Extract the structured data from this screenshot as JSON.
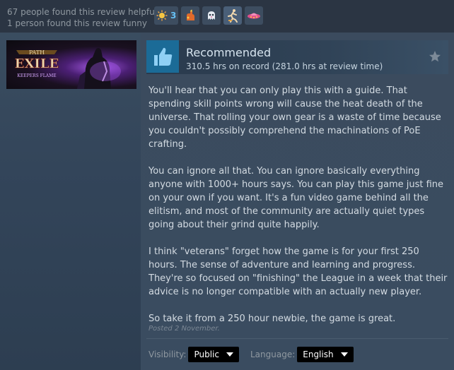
{
  "helpful": {
    "helpful_text": "67 people found this review helpful",
    "funny_text": "1 person found this review funny"
  },
  "awards": [
    {
      "icon": "sun-award-icon",
      "count": "3"
    },
    {
      "icon": "flame-hand-award-icon",
      "count": ""
    },
    {
      "icon": "ghost-award-icon",
      "count": ""
    },
    {
      "icon": "runner-award-icon",
      "count": ""
    },
    {
      "icon": "pink-ufo-award-icon",
      "count": ""
    }
  ],
  "game": {
    "logo_line1": "PATH",
    "logo_line2": "EXILE",
    "logo_line3": "KEEPERS FLAME"
  },
  "review": {
    "verdict": "Recommended",
    "hours": "310.5 hrs on record (281.0 hrs at review time)",
    "paragraphs": [
      "You'll hear that you can only play this with a guide. That spending skill points wrong will cause the heat death of the universe. That rolling your own gear is a waste of time because you couldn't possibly comprehend the machinations of PoE crafting.",
      "You can ignore all that. You can ignore basically everything anyone with 1000+ hours says. You can play this game just fine on your own if you want. It's a fun video game behind all the elitism, and most of the community are actually quiet types going about their grind quite happily.",
      "I think \"veterans\" forget how the game is for your first 250 hours. The sense of adventure and learning and progress. They're so focused on \"finishing\" the League in a week that their advice is no longer compatible with an actually new player.",
      "So take it from a 250 hour newbie, the game is great."
    ],
    "posted": "Posted 2 November."
  },
  "controls": {
    "visibility_label": "Visibility:",
    "visibility_value": "Public",
    "language_label": "Language:",
    "language_value": "English"
  },
  "colors": {
    "thumb_bg": "#1b6b97",
    "award_count": "#67c1f5"
  }
}
